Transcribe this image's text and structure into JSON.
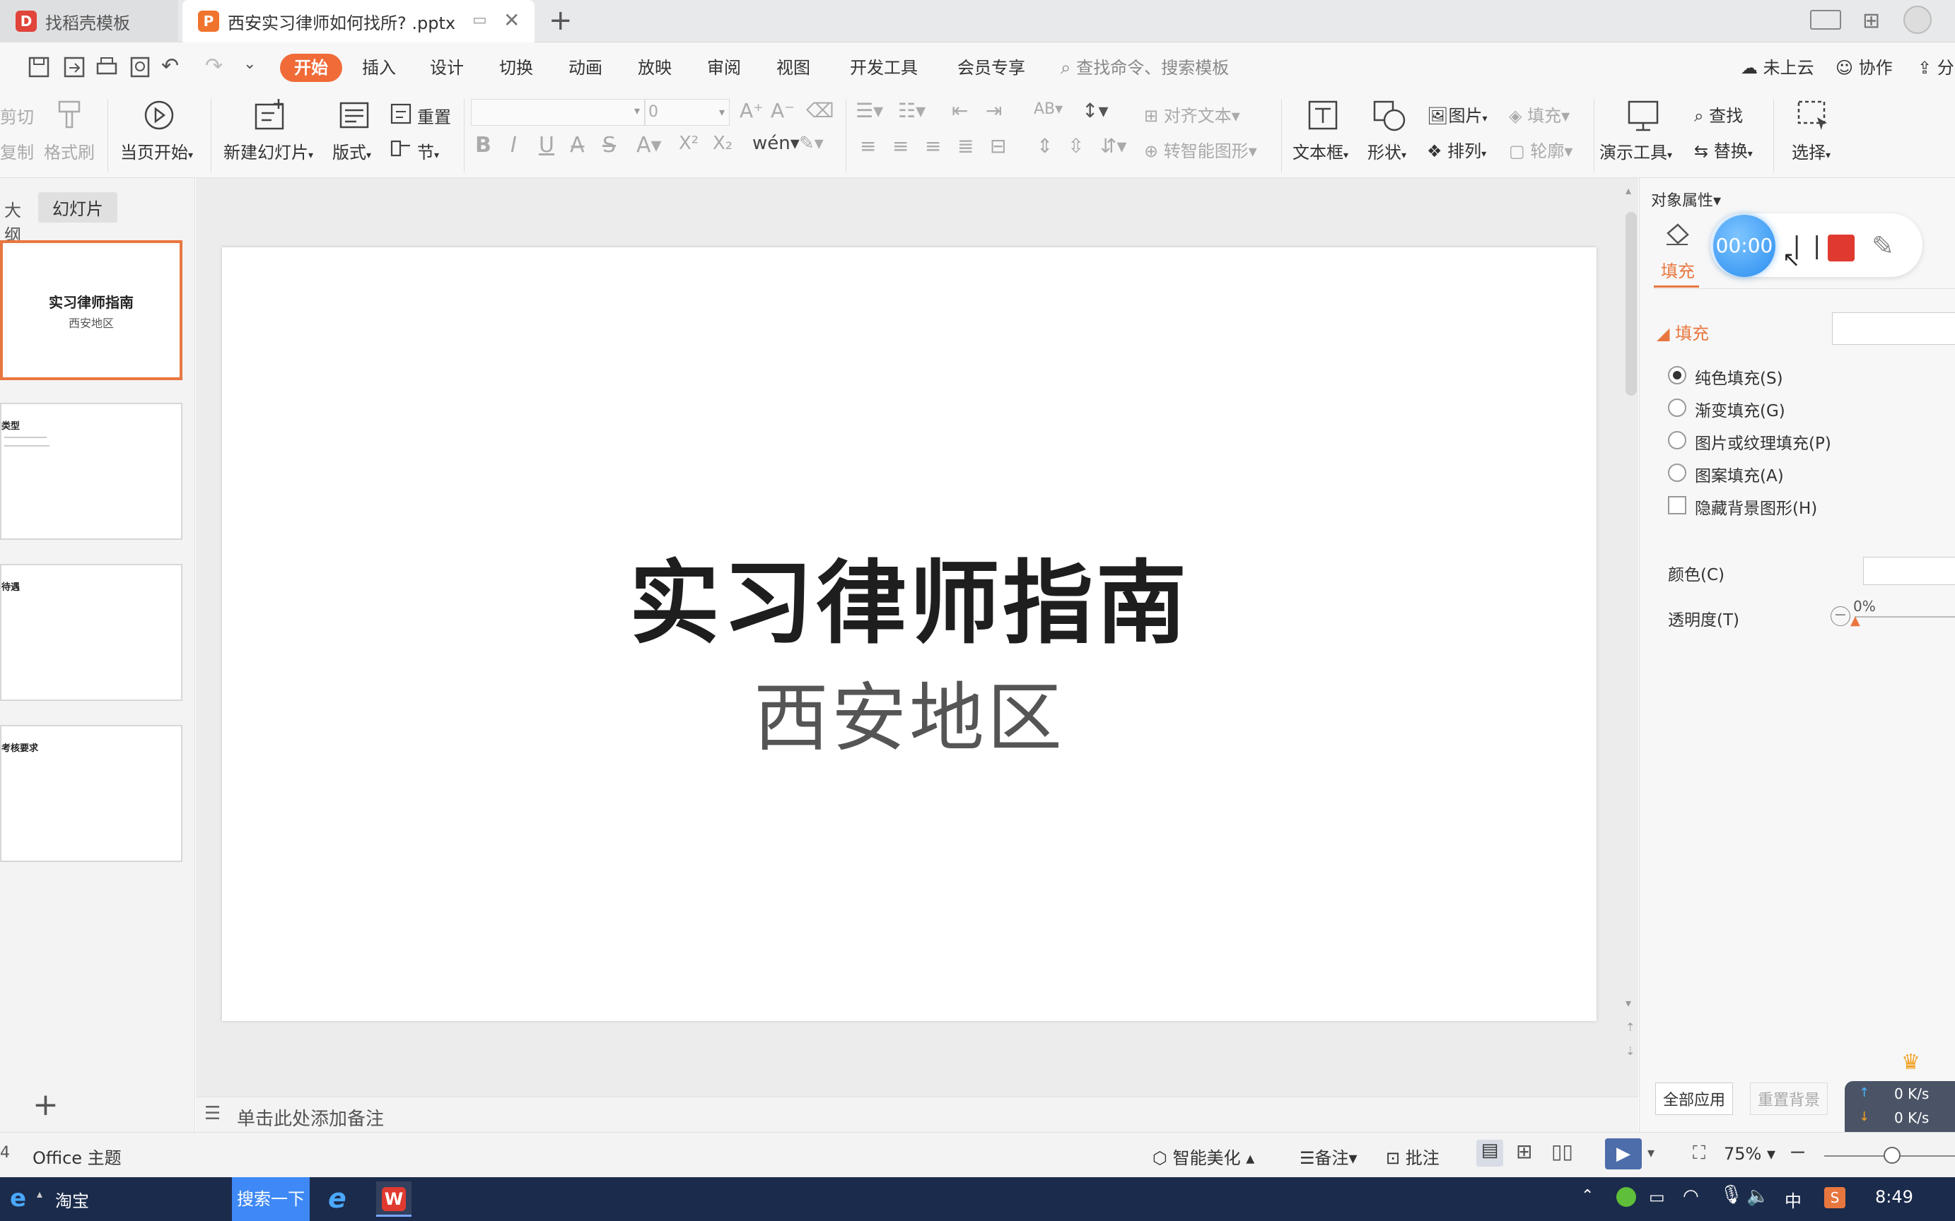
{
  "tabs": [
    {
      "label": "找稻壳模板",
      "logo": "D"
    },
    {
      "label": "西安实习律师如何找所? .pptx",
      "logo": "P"
    }
  ],
  "menu": {
    "items": [
      "开始",
      "插入",
      "设计",
      "切换",
      "动画",
      "放映",
      "审阅",
      "视图",
      "开发工具",
      "会员专享"
    ],
    "search_placeholder": "查找命令、搜索模板",
    "cloud": "未上云",
    "collab": "协作",
    "share": "分"
  },
  "ribbon": {
    "cut": "剪切",
    "copy": "复制",
    "format_painter": "格式刷",
    "start_from_current": "当页开始",
    "new_slide": "新建幻灯片",
    "layout": "版式",
    "reset": "重置",
    "section": "节",
    "font_size": "0",
    "align_text": "对齐文本",
    "smart_art": "转智能图形",
    "text_box": "文本框",
    "shape": "形状",
    "picture": "图片",
    "arrange": "排列",
    "fill": "填充",
    "outline": "轮廓",
    "present_tools": "演示工具",
    "find": "查找",
    "replace": "替换",
    "select": "选择"
  },
  "left_panel": {
    "tab_outline": "大纲",
    "tab_slides": "幻灯片",
    "slides": [
      {
        "title": "实习律师指南",
        "subtitle": "西安地区"
      },
      {
        "title": "类型",
        "subtitle": ""
      },
      {
        "title": "待遇",
        "subtitle": ""
      },
      {
        "title": "考核要求",
        "subtitle": ""
      }
    ],
    "add": "+"
  },
  "slide": {
    "title": "实习律师指南",
    "subtitle": "西安地区"
  },
  "notes_placeholder": "单击此处添加备注",
  "right_panel": {
    "header": "对象属性",
    "fill_tab": "填充",
    "recorder_time": "00:00",
    "section_fill": "填充",
    "options": [
      {
        "label": "纯色填充(S)",
        "checked": true
      },
      {
        "label": "渐变填充(G)",
        "checked": false
      },
      {
        "label": "图片或纹理填充(P)",
        "checked": false
      },
      {
        "label": "图案填充(A)",
        "checked": false
      }
    ],
    "hide_bg": "隐藏背景图形(H)",
    "color_label": "颜色(C)",
    "transparency_label": "透明度(T)",
    "transparency_value": "0%",
    "apply_all": "全部应用",
    "reset_bg": "重置背景",
    "net_up": "0 K/s",
    "net_down": "0 K/s"
  },
  "status": {
    "slide_num": "4",
    "theme": "Office 主题",
    "beautify": "智能美化",
    "notes": "备注",
    "comment": "批注",
    "zoom": "75%"
  },
  "taskbar": {
    "browser_label": "淘宝",
    "search_btn": "搜索一下",
    "ime": "中",
    "time": "8:49"
  }
}
